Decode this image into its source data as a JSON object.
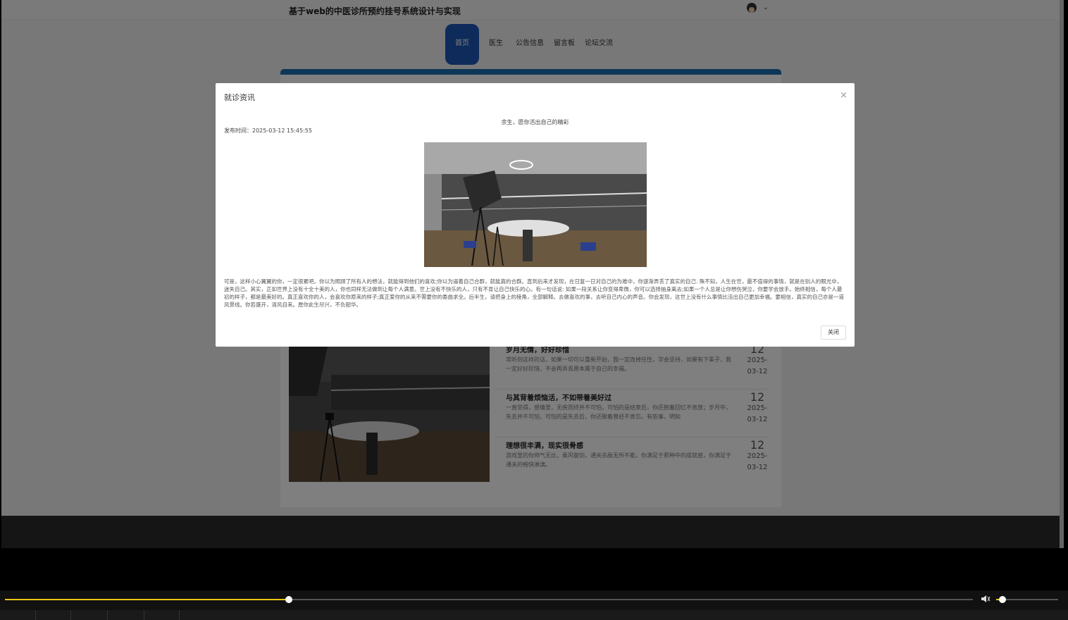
{
  "site": {
    "title": "基于web的中医诊所预约挂号系统设计与实现"
  },
  "nav": {
    "items": [
      {
        "label": "首页",
        "active": true
      },
      {
        "label": "医生",
        "active": false
      },
      {
        "label": "公告信息",
        "active": false
      },
      {
        "label": "留言板",
        "active": false
      },
      {
        "label": "论坛交流",
        "active": false
      }
    ]
  },
  "news": [
    {
      "title": "岁月无情，好好珍惜",
      "desc": "常听到这样的话，如果一切可以重新开始，我一定改掉任性，学会坚持，如果有下辈子，我一定好好珍惜，不会再弄丢原本属于自己的幸福。",
      "day": "12",
      "date": "2025-03-12"
    },
    {
      "title": "与其背着烦恼活，不如带着美好过",
      "desc": "一直觉得，感情里，无疾而终并不可怕，可怕的是结束后，你还抱着回忆不肯放；岁月中，失去并不可怕，可怕的是失去后，你还揪着曾经不肯忘。有些事，明知",
      "day": "12",
      "date": "2025-03-12"
    },
    {
      "title": "理想很丰满，现实很骨感",
      "desc": "游戏里的你帅气无比，乘风御剑，通关杀敌无所不能。你满足于那种中的成就感，你满足于通关的畅快淋漓。",
      "day": "12",
      "date": "2025-03-12"
    }
  ],
  "modal": {
    "title": "就诊资讯",
    "subtitle": "余生，愿你活出自己的精彩",
    "time": "发布时间：2025-03-12 15:45:55",
    "body": "可是，这样小心翼翼的你，一定很累吧。你以为照顾了所有人的想法，就能得到他们的喜欢;你以为逼着自己合群，就能真的合群。直到后来才发现，在日复一日对自己的为难中，你逐渐弄丢了真实的自己. 殊不知，人生在世，最不值得的事情，就是在别人的眼光中，迷失自己。其实，正如世界上没有十全十美的人，你也同样无法做到让每个人满意。世上没有不快乐的人，只有不肯让自己快乐的心。有一句话说: 如果一段关系让你变得卑微，你可以选择抽身离去;如果一个人总是让你想伤哭泣，你要学会放手。始终相信，每个人最初的样子，都是最美好的。真正喜欢你的人，会喜欢你原来的样子;真正爱你的从来不需要你的委曲求全。后半生，请把身上的棱角，全部解释。去做喜欢的事，去听自己内心的声音。你会发现，这世上没有什么事情比活出自己更加幸福。要相信，真实的自己亦是一道风景线。你若盛开，清风自来。愿你此生尽兴，不负韶华。",
    "close_button": "关闭",
    "close_icon": "×"
  },
  "player": {
    "progress": 0.293,
    "volume": 0.1
  },
  "colors": {
    "nav_active": "#1f56b8",
    "accent_bar": "#1b6fb0",
    "progress": "#e8c614"
  }
}
